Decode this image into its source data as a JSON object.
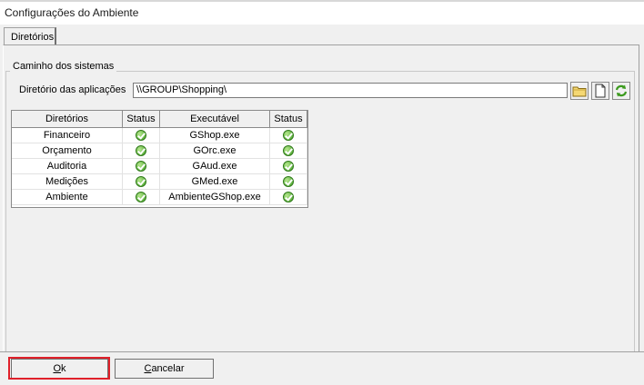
{
  "window": {
    "title": "Configurações do Ambiente"
  },
  "tabs": [
    {
      "label": "Diretórios"
    }
  ],
  "group": {
    "label": "Caminho dos sistemas"
  },
  "directory": {
    "label": "Diretório das aplicações",
    "value": "\\\\GROUP\\Shopping\\"
  },
  "tools": {
    "browse_icon": "folder-icon",
    "new_icon": "document-icon",
    "refresh_icon": "refresh-icon"
  },
  "grid": {
    "columns": [
      "Diretórios",
      "Status",
      "Executável",
      "Status"
    ],
    "rows": [
      {
        "dir": "Financeiro",
        "exe": "GShop.exe"
      },
      {
        "dir": "Orçamento",
        "exe": "GOrc.exe"
      },
      {
        "dir": "Auditoria",
        "exe": "GAud.exe"
      },
      {
        "dir": "Medições",
        "exe": "GMed.exe"
      },
      {
        "dir": "Ambiente",
        "exe": "AmbienteGShop.exe"
      }
    ],
    "status_icon": "ok-check-icon"
  },
  "buttons": {
    "ok": {
      "underlined": "O",
      "rest": "k"
    },
    "cancel": {
      "underlined": "C",
      "rest": "ancelar"
    }
  },
  "colors": {
    "highlight": "#e0202a",
    "check": "#3f9e24"
  }
}
